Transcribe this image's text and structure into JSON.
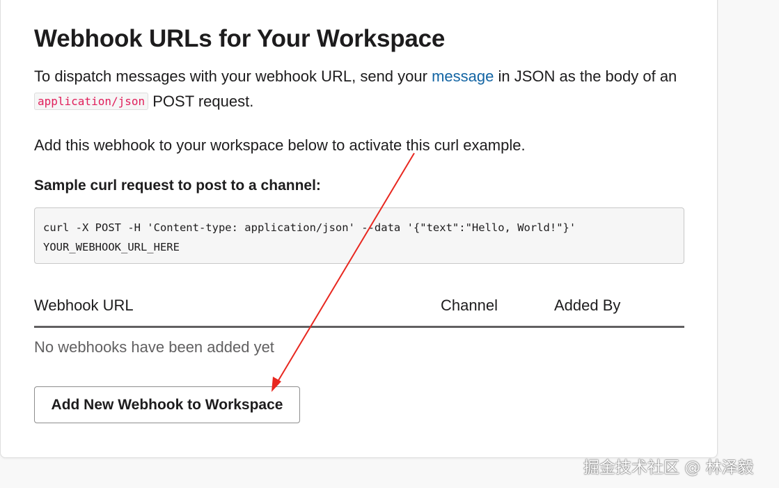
{
  "page": {
    "title": "Webhook URLs for Your Workspace",
    "intro": {
      "before_link": "To dispatch messages with your webhook URL, send your ",
      "link_text": "message",
      "after_link": " in JSON as the body of an ",
      "code": "application/json",
      "after_code": " POST request."
    },
    "activate_text": "Add this webhook to your workspace below to activate this curl example.",
    "sample_heading": "Sample curl request to post to a channel:",
    "curl_example": "curl -X POST -H 'Content-type: application/json' --data '{\"text\":\"Hello, World!\"}'\nYOUR_WEBHOOK_URL_HERE",
    "table": {
      "columns": [
        "Webhook URL",
        "Channel",
        "Added By"
      ],
      "empty_text": "No webhooks have been added yet"
    },
    "add_button_label": "Add New Webhook to Workspace"
  },
  "annotation": {
    "arrow_color": "#e8271f",
    "watermark": "掘金技术社区 @ 林泽毅"
  },
  "colors": {
    "link": "#1264a3",
    "code_text": "#e01e5a",
    "muted_text": "#616061"
  }
}
